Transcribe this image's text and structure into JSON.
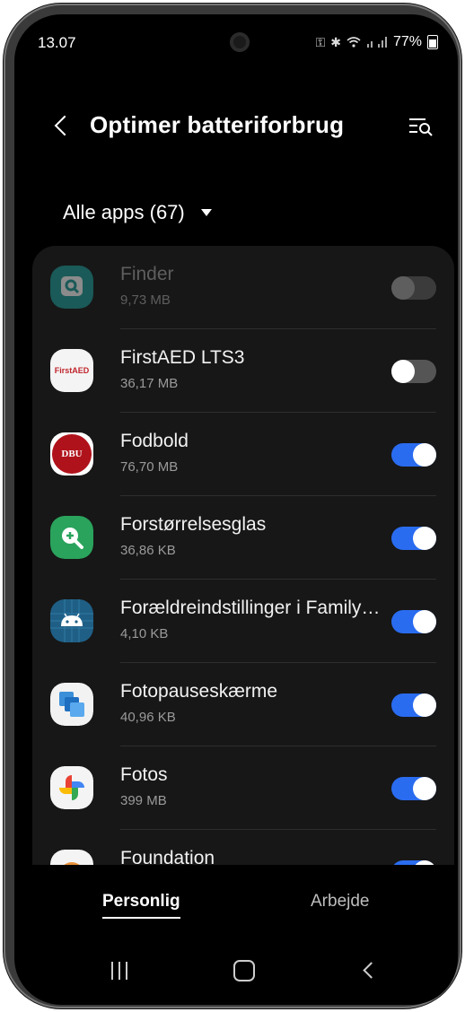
{
  "status_bar": {
    "time": "13.07",
    "battery": "77%"
  },
  "header": {
    "title": "Optimer batteriforbrug"
  },
  "filter": {
    "label": "Alle apps (67)"
  },
  "apps": [
    {
      "name": "Finder",
      "size": "9,73 MB",
      "toggle": "disabled",
      "icon": "finder-icon"
    },
    {
      "name": "FirstAED LTS3",
      "size": "36,17 MB",
      "toggle": "off",
      "icon": "firstaed-icon",
      "icon_text": "FirstAED"
    },
    {
      "name": "Fodbold",
      "size": "76,70 MB",
      "toggle": "on",
      "icon": "dbu-crest-icon",
      "icon_text": "DBU"
    },
    {
      "name": "Forstørrelsesglas",
      "size": "36,86 KB",
      "toggle": "on",
      "icon": "magnifier-icon"
    },
    {
      "name": "Forældreindstillinger i Family Link",
      "size": "4,10 KB",
      "toggle": "on",
      "icon": "android-icon"
    },
    {
      "name": "Fotopauseskærme",
      "size": "40,96 KB",
      "toggle": "on",
      "icon": "photo-screensaver-icon"
    },
    {
      "name": "Fotos",
      "size": "399 MB",
      "toggle": "on",
      "icon": "google-photos-icon"
    },
    {
      "name": "Foundation",
      "size": "",
      "toggle": "on",
      "icon": "foundation-icon"
    }
  ],
  "tabs": {
    "personal": "Personlig",
    "work": "Arbejde"
  },
  "colors": {
    "accent": "#2a6cf0",
    "background": "#000000",
    "list_background": "#171717"
  }
}
